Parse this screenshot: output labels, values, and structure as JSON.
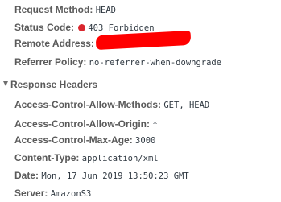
{
  "general": {
    "request_method": {
      "key": "Request Method:",
      "value": "HEAD"
    },
    "status_code": {
      "key": "Status Code:",
      "value": "403 Forbidden",
      "status_color": "#d9272e"
    },
    "remote_address": {
      "key": "Remote Address:",
      "value": ""
    },
    "referrer_policy": {
      "key": "Referrer Policy:",
      "value": "no-referrer-when-downgrade"
    }
  },
  "response_headers": {
    "title": "Response Headers",
    "expanded": true,
    "items": [
      {
        "key": "Access-Control-Allow-Methods:",
        "value": "GET, HEAD"
      },
      {
        "key": "Access-Control-Allow-Origin:",
        "value": "*"
      },
      {
        "key": "Access-Control-Max-Age:",
        "value": "3000"
      },
      {
        "key": "Content-Type:",
        "value": "application/xml"
      },
      {
        "key": "Date:",
        "value": "Mon, 17 Jun 2019 13:50:23 GMT"
      },
      {
        "key": "Server:",
        "value": "AmazonS3"
      }
    ]
  },
  "colors": {
    "redaction": "#ff0000",
    "key_text": "#5a5a5a",
    "value_text": "#303942"
  }
}
